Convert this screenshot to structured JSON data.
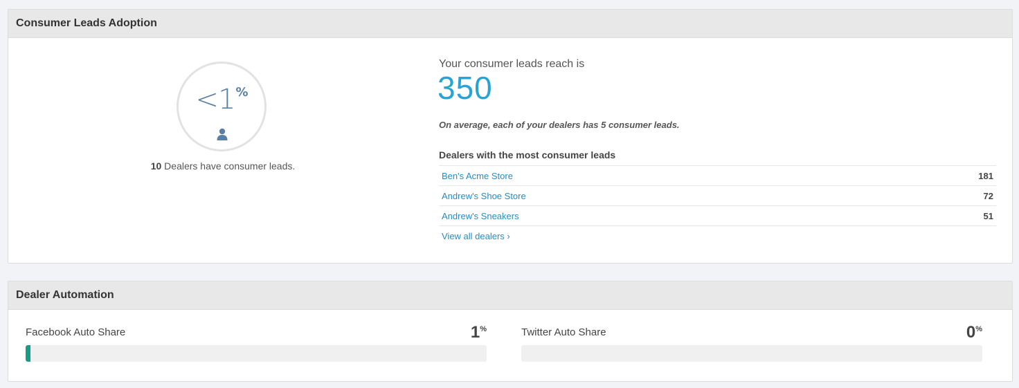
{
  "adoption": {
    "title": "Consumer Leads Adoption",
    "ring_value": "<1",
    "ring_unit": "%",
    "icon": "user-icon",
    "caption_count": "10",
    "caption_text": " Dealers have consumer leads.",
    "reach_label": "Your consumer leads reach is",
    "reach_value": "350",
    "avg_text": "On average, each of your dealers has 5 consumer leads.",
    "dealers_heading": "Dealers with the most consumer leads",
    "dealers": [
      {
        "name": "Ben's Acme Store",
        "count": "181"
      },
      {
        "name": "Andrew's Shoe Store",
        "count": "72"
      },
      {
        "name": "Andrew's Sneakers",
        "count": "51"
      }
    ],
    "view_all": "View all dealers ›"
  },
  "automation": {
    "title": "Dealer Automation",
    "facebook": {
      "label": "Facebook Auto Share",
      "value": "1",
      "unit": "%",
      "fraction": 0.01
    },
    "twitter": {
      "label": "Twitter Auto Share",
      "value": "0",
      "unit": "%",
      "fraction": 0
    }
  },
  "colors": {
    "accent": "#2aa3d4",
    "link": "#2a8bbf",
    "ring_text": "#5a7fa6",
    "bar_fill": "#1a9b86"
  }
}
